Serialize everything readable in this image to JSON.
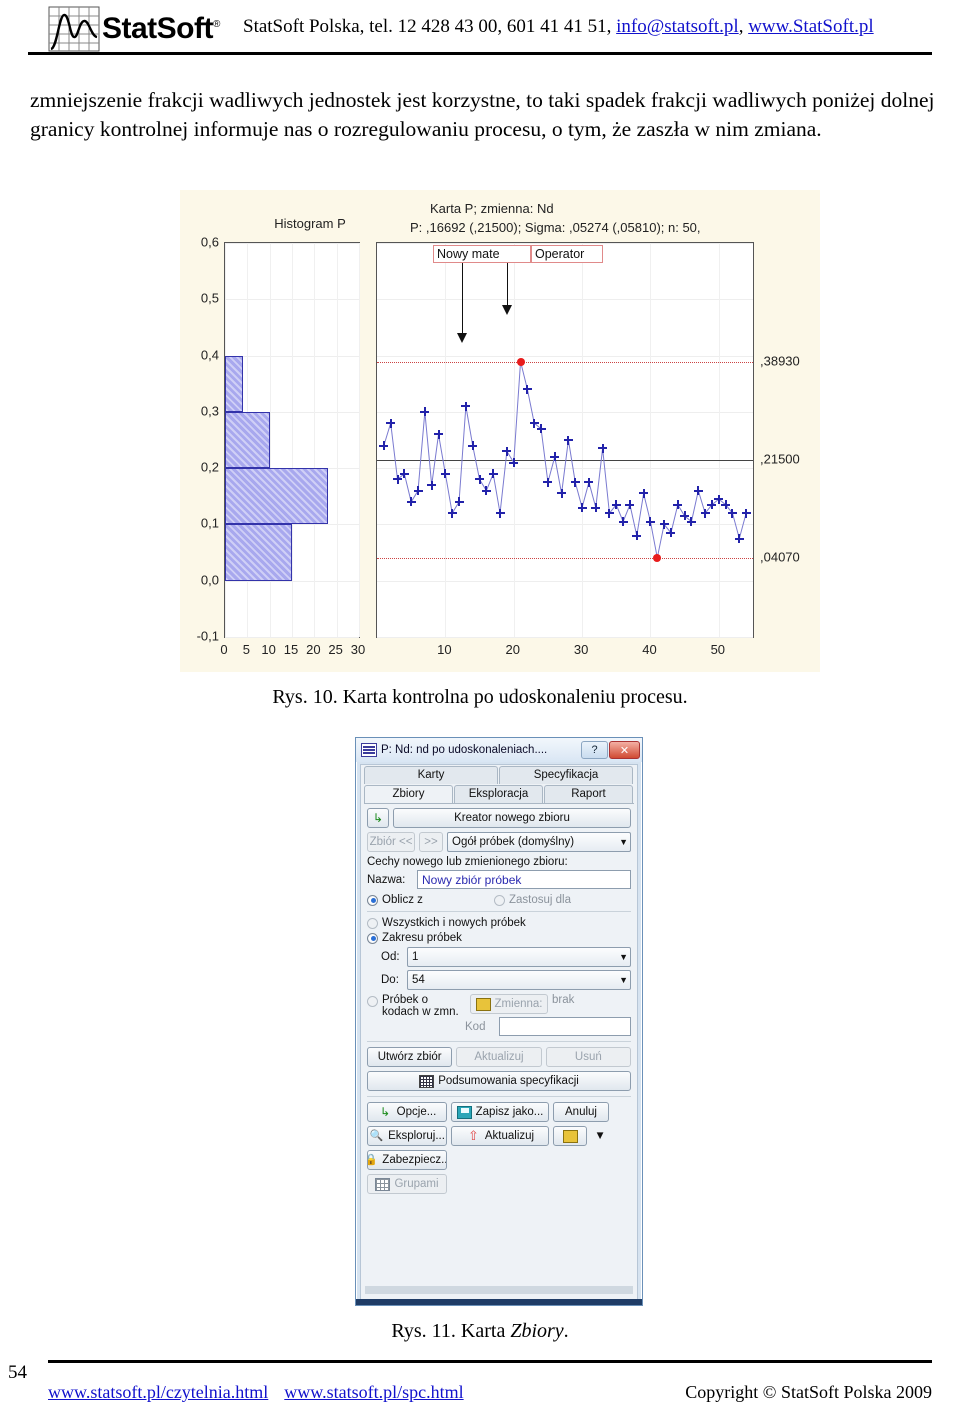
{
  "header": {
    "logo_text": "StatSoft",
    "logo_reg": "®",
    "contact_prefix": "StatSoft Polska, tel. 12 428 43 00, 601 41 41 51, ",
    "email": "info@statsoft.pl",
    "sep": ", ",
    "website": "www.StatSoft.pl"
  },
  "paragraph": "zmniejszenie frakcji wadliwych jednostek jest korzystne, to taki spadek frakcji wadliwych poniżej dolnej granicy kontrolnej informuje nas o rozregulowaniu procesu, o tym, że zaszła w nim zmiana.",
  "figure10": {
    "caption_prefix": "Rys. 10. Karta kontrolna po udoskonaleniu procesu.",
    "hist_title": "Histogram P",
    "chart_title_line1": "Karta P; zmienna:  Nd",
    "chart_title_line2": "P: ,16692 (,21500); Sigma: ,05274 (,05810); n: 50,",
    "annotations": [
      {
        "label": "Nowy mate",
        "x_sample": 12.5
      },
      {
        "label": "Operator",
        "x_sample": 19.0
      }
    ],
    "right_labels": {
      "ucl": ",38930",
      "center": ",21500",
      "lcl": ",04070"
    },
    "colors": {
      "background": "#fcf8e8",
      "plot_background": "#ffffff",
      "point": "#2222aa",
      "violation": "#e81c1c",
      "limit_line": "#cc4444",
      "hist_fill": "#a8a8ee",
      "hist_border": "#3333aa",
      "annotation_border": "#e08a8a"
    }
  },
  "chart_data": [
    {
      "type": "bar",
      "title": "Histogram P",
      "orientation": "horizontal",
      "xlabel": "",
      "ylabel": "",
      "xlim": [
        0,
        30
      ],
      "ylim": [
        -0.1,
        0.6
      ],
      "xticks": [
        0,
        5,
        10,
        15,
        20,
        25,
        30
      ],
      "yticks": [
        -0.1,
        0.0,
        0.1,
        0.2,
        0.3,
        0.4,
        0.5,
        0.6
      ],
      "ytick_labels": [
        "-0,1",
        "0,0",
        "0,1",
        "0,2",
        "0,3",
        "0,4",
        "0,5",
        "0,6"
      ],
      "grid": true,
      "categories": [
        "0,0-0,1",
        "0,1-0,2",
        "0,2-0,3",
        "0,3-0,4"
      ],
      "bin_edges": [
        0.0,
        0.1,
        0.2,
        0.3,
        0.4
      ],
      "values": [
        15,
        23,
        10,
        4
      ]
    },
    {
      "type": "line",
      "title": "Karta P; zmienna:  Nd",
      "subtitle": "P: ,16692 (,21500); Sigma: ,05274 (,05810); n: 50,",
      "xlabel": "",
      "ylabel": "",
      "xlim": [
        0,
        55
      ],
      "ylim": [
        -0.1,
        0.6
      ],
      "xticks": [
        10,
        20,
        30,
        40,
        50
      ],
      "yticks": [
        -0.1,
        0.0,
        0.1,
        0.2,
        0.3,
        0.4,
        0.5,
        0.6
      ],
      "grid": true,
      "center_line": 0.215,
      "ucl": 0.3893,
      "lcl": 0.0407,
      "p_estimate": 0.16692,
      "sigma": 0.05274,
      "n": 50,
      "legend": [],
      "x": [
        1,
        2,
        3,
        4,
        5,
        6,
        7,
        8,
        9,
        10,
        11,
        12,
        13,
        14,
        15,
        16,
        17,
        18,
        19,
        20,
        21,
        22,
        23,
        24,
        25,
        26,
        27,
        28,
        29,
        30,
        31,
        32,
        33,
        34,
        35,
        36,
        37,
        38,
        39,
        40,
        41,
        42,
        43,
        44,
        45,
        46,
        47,
        48,
        49,
        50,
        51,
        52,
        53,
        54
      ],
      "values": [
        0.24,
        0.28,
        0.18,
        0.19,
        0.14,
        0.16,
        0.3,
        0.17,
        0.26,
        0.19,
        0.12,
        0.14,
        0.31,
        0.24,
        0.18,
        0.16,
        0.19,
        0.12,
        0.23,
        0.21,
        0.3893,
        0.34,
        0.28,
        0.27,
        0.175,
        0.22,
        0.155,
        0.25,
        0.175,
        0.13,
        0.175,
        0.13,
        0.235,
        0.12,
        0.135,
        0.105,
        0.135,
        0.08,
        0.155,
        0.105,
        0.0407,
        0.1,
        0.085,
        0.135,
        0.115,
        0.105,
        0.16,
        0.12,
        0.135,
        0.145,
        0.135,
        0.12,
        0.075,
        0.12
      ],
      "out_of_control_points": [
        {
          "sample": 21,
          "value": 0.3893
        },
        {
          "sample": 41,
          "value": 0.0407
        }
      ],
      "annotations": [
        {
          "text": "Nowy mate",
          "points_to_sample": 12.5
        },
        {
          "text": "Operator",
          "points_to_sample": 19.0
        }
      ]
    }
  ],
  "figure11": {
    "caption_prefix": "Rys. 11. Karta ",
    "caption_italic": "Zbiory",
    "caption_suffix": ".",
    "dialog": {
      "title": "P: Nd: nd po udoskonaleniach....",
      "help_button": "?",
      "close_button": "✕",
      "tabs_row1": [
        {
          "label": "Karty",
          "active": false
        },
        {
          "label": "Specyfikacja",
          "active": false
        }
      ],
      "tabs_row2": [
        {
          "label": "Zbiory",
          "active": true
        },
        {
          "label": "Eksploracja",
          "active": false
        },
        {
          "label": "Raport",
          "active": false
        }
      ],
      "wizard_button": "Kreator nowego zbioru",
      "prev_button": "Zbiór <<",
      "next_button": ">>",
      "set_combo": "Ogół próbek (domyślny)",
      "group_label": "Cechy nowego lub zmienionego zbioru:",
      "name_label": "Nazwa:",
      "name_value": "Nowy zbiór próbek",
      "radio_compute": "Oblicz z",
      "radio_apply": "Zastosuj dla",
      "radio_all_new": "Wszystkich i nowych próbek",
      "radio_range": "Zakresu próbek",
      "from_label": "Od:",
      "from_value": "1",
      "to_label": "Do:",
      "to_value": "54",
      "radio_codes_l1": "Próbek o",
      "radio_codes_l2": "kodach w zmn.",
      "variable_button": "Zmienna:",
      "variable_value": "brak",
      "code_label": "Kod",
      "code_value": "",
      "create_button": "Utwórz zbiór",
      "update_button_top": "Aktualizuj",
      "delete_button": "Usuń",
      "summary_button": "Podsumowania specyfikacji",
      "options_button": "Opcje...",
      "saveas_button": "Zapisz jako...",
      "cancel_button": "Anuluj",
      "explore_button": "Eksploruj...",
      "update_button": "Aktualizuj",
      "secure_button": "Zabezpiecz...",
      "groups_button": "Grupami",
      "dropdown_caret": "▼"
    }
  },
  "footer": {
    "page_number": "54",
    "link1": "www.statsoft.pl/czytelnia.html",
    "link2": "www.statsoft.pl/spc.html",
    "copyright": "Copyright © StatSoft Polska 2009"
  }
}
